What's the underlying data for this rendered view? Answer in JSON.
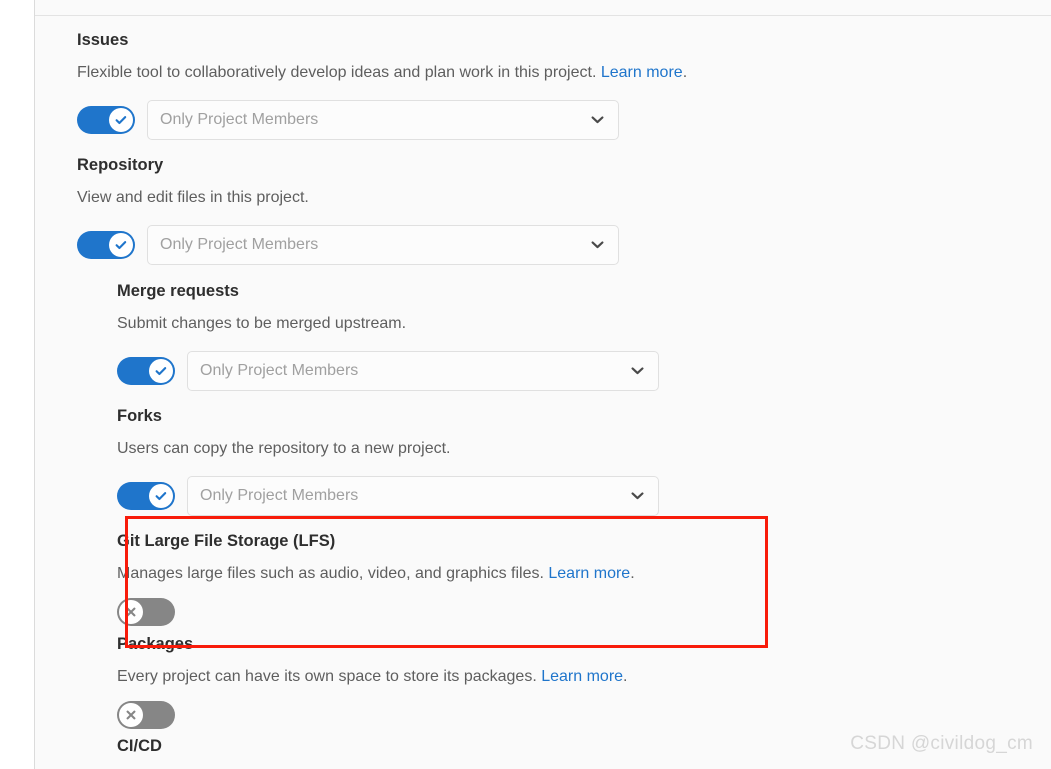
{
  "page": {
    "clipped_top_row": "",
    "watermark": "CSDN @civildog_cm"
  },
  "colors": {
    "toggle_on": "#1f75cb",
    "toggle_off": "#868686",
    "link": "#1f75cb",
    "annotation": "#f81b0a",
    "panel_bg": "#fafafa",
    "heading": "#2e2e2e",
    "body_text": "#5e5e5e"
  },
  "sections": {
    "issues": {
      "title": "Issues",
      "desc": "Flexible tool to collaboratively develop ideas and plan work in this project.",
      "link": "Learn more",
      "desc_tail": ".",
      "toggle_state": "on",
      "select_value": "Only Project Members"
    },
    "repository": {
      "title": "Repository",
      "desc": "View and edit files in this project.",
      "toggle_state": "on",
      "select_value": "Only Project Members"
    },
    "merge_requests": {
      "title": "Merge requests",
      "desc": "Submit changes to be merged upstream.",
      "toggle_state": "on",
      "select_value": "Only Project Members"
    },
    "forks": {
      "title": "Forks",
      "desc": "Users can copy the repository to a new project.",
      "toggle_state": "on",
      "select_value": "Only Project Members"
    },
    "lfs": {
      "title": "Git Large File Storage (LFS)",
      "desc": "Manages large files such as audio, video, and graphics files.",
      "link": "Learn more",
      "desc_tail": ".",
      "toggle_state": "off",
      "highlighted": true
    },
    "packages": {
      "title": "Packages",
      "desc": "Every project can have its own space to store its packages.",
      "link": "Learn more",
      "desc_tail": ".",
      "toggle_state": "off"
    },
    "cicd": {
      "title": "CI/CD"
    }
  }
}
